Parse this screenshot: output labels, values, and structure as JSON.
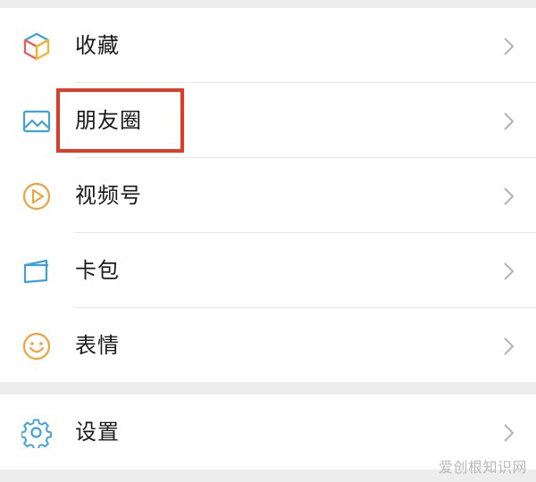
{
  "menu": {
    "items": [
      {
        "label": "收藏",
        "icon": "favorites-cube-icon"
      },
      {
        "label": "朋友圈",
        "icon": "moments-photo-icon"
      },
      {
        "label": "视频号",
        "icon": "channels-play-icon"
      },
      {
        "label": "卡包",
        "icon": "card-wallet-icon"
      },
      {
        "label": "表情",
        "icon": "sticker-smiley-icon"
      }
    ],
    "settings": {
      "label": "设置",
      "icon": "settings-gear-icon"
    }
  },
  "highlight": {
    "target": "朋友圈",
    "color": "#e23b25"
  },
  "watermark": "爱创根知识网",
  "colors": {
    "background": "#ededed",
    "row": "#ffffff",
    "text": "#1a1a1a",
    "chevron": "#b2b2b2",
    "divider": "#e6e6e6"
  }
}
